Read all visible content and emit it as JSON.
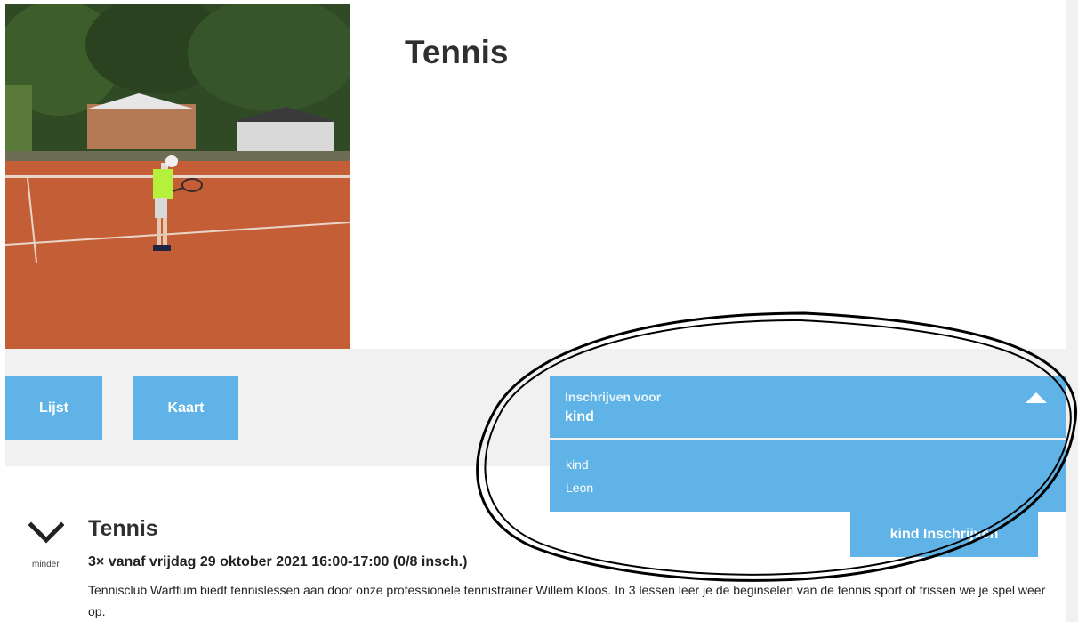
{
  "header": {
    "title": "Tennis"
  },
  "view_buttons": {
    "list_label": "Lijst",
    "map_label": "Kaart"
  },
  "enroll_select": {
    "label": "Inschrijven voor",
    "selected": "kind",
    "options": [
      "kind",
      "Leon"
    ],
    "expanded": true
  },
  "enroll_button": {
    "label": "kind Inschrijven"
  },
  "course": {
    "toggle_label": "minder",
    "title": "Tennis",
    "schedule": "3× vanaf vrijdag 29 oktober 2021 16:00-17:00 (0/8 insch.)",
    "description": "Tennisclub Warffum biedt tennislessen aan door onze professionele tennistrainer Willem Kloos. In 3 lessen leer je de beginselen van de tennis sport of frissen we je spel weer op."
  },
  "colors": {
    "accent": "#5fb3e6",
    "band": "#f1f1f1",
    "text": "#2f2f2f"
  },
  "icons": {
    "collapse": "chevron-down-icon",
    "dropdown": "caret-up-icon"
  }
}
